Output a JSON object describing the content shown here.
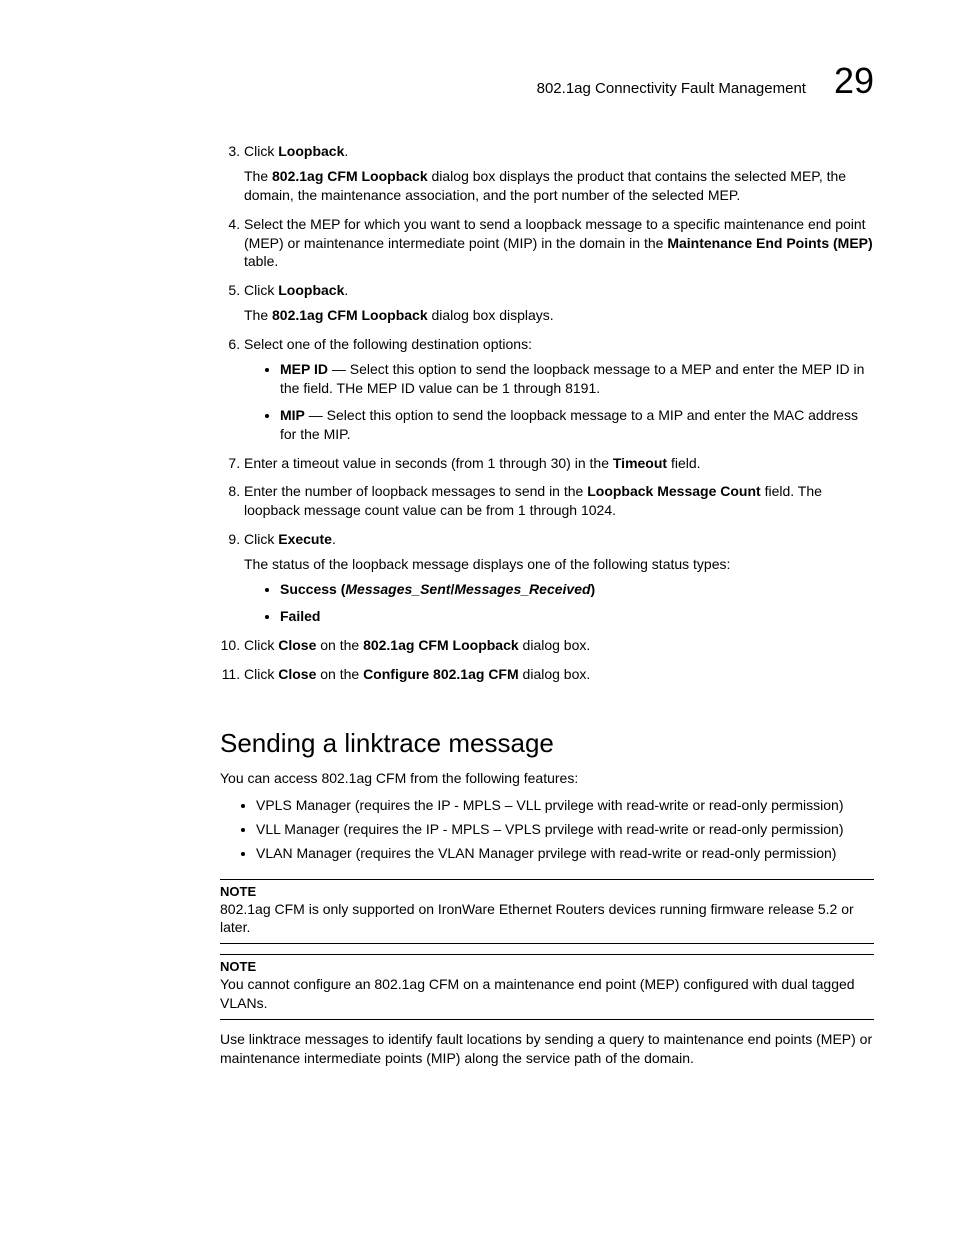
{
  "header": {
    "title": "802.1ag Connectivity Fault Management",
    "chapter": "29"
  },
  "steps": {
    "s3": {
      "pre": "Click ",
      "b1": "Loopback",
      "post": ".",
      "desc_pre": "The ",
      "desc_b": "802.1ag CFM Loopback",
      "desc_post": " dialog box displays the product that contains the selected MEP, the domain, the maintenance association, and the port number of the selected MEP."
    },
    "s4": {
      "pre": "Select the MEP for which you want to send a loopback message to a specific maintenance end point (MEP) or maintenance intermediate point (MIP) in the domain in the ",
      "b1": "Maintenance End Points (MEP)",
      "post": " table."
    },
    "s5": {
      "pre": "Click ",
      "b1": "Loopback",
      "post": ".",
      "desc_pre": "The ",
      "desc_b": "802.1ag CFM Loopback",
      "desc_post": " dialog box displays."
    },
    "s6": {
      "text": "Select one of the following destination options:",
      "b1_b": "MEP ID",
      "b1_post": " — Select this option to send the loopback message to a MEP and enter the MEP ID in the field. THe MEP ID value can be 1 through 8191.",
      "b2_b": "MIP",
      "b2_post": " — Select this option to send the loopback message to a MIP and enter the MAC address for the MIP."
    },
    "s7": {
      "pre": "Enter a timeout value in seconds (from 1 through 30) in the ",
      "b1": "Timeout",
      "post": " field."
    },
    "s8": {
      "pre": "Enter the number of loopback messages to send in the ",
      "b1": "Loopback Message Count",
      "post": " field. The loopback message count value can be from 1 through 1024."
    },
    "s9": {
      "pre": "Click ",
      "b1": "Execute",
      "post": ".",
      "desc": "The status of the loopback message displays one of the following status types:",
      "b1_b": "Success (",
      "b1_i": "Messages_Sent",
      "b1_sep": "/",
      "b1_i2": "Messages_Received",
      "b1_close": ")",
      "b2_b": "Failed"
    },
    "s10": {
      "pre": "Click ",
      "b1": "Close",
      "mid": " on the ",
      "b2": "802.1ag CFM Loopback",
      "post": " dialog box."
    },
    "s11": {
      "pre": "Click ",
      "b1": "Close",
      "mid": " on the ",
      "b2": "Configure 802.1ag CFM",
      "post": " dialog box."
    }
  },
  "section": {
    "heading": "Sending a linktrace message",
    "intro": "You can access 802.1ag CFM from the following features:",
    "features": [
      "VPLS Manager (requires the IP - MPLS – VLL prvilege with read-write or read-only permission)",
      "VLL Manager (requires the IP - MPLS – VPLS prvilege with read-write or read-only permission)",
      "VLAN Manager (requires the VLAN Manager prvilege with read-write or read-only permission)"
    ],
    "note1": {
      "label": "NOTE",
      "text": "802.1ag CFM is only supported on IronWare Ethernet Routers devices running firmware release 5.2 or later."
    },
    "note2": {
      "label": "NOTE",
      "text": "You cannot configure an 802.1ag CFM on a maintenance end point (MEP) configured with dual tagged VLANs."
    },
    "closing": "Use linktrace messages to identify fault locations by sending a query to maintenance end points (MEP) or maintenance intermediate points (MIP) along the service path of the domain."
  }
}
